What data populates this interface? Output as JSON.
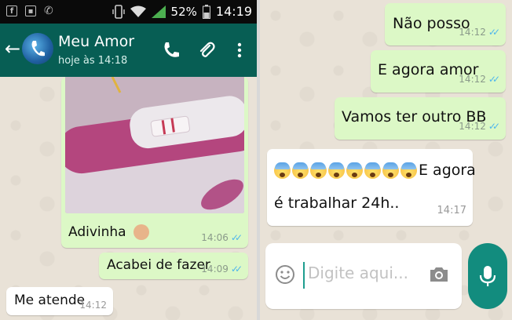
{
  "status_bar": {
    "battery": "52%",
    "time": "14:19"
  },
  "header": {
    "contact_name": "Meu Amor",
    "last_seen": "hoje às 14:18"
  },
  "left_messages": {
    "photo_caption": "Adivinha",
    "photo_time": "14:06",
    "msg2_text": "Acabei de fazer",
    "msg2_time": "14:09",
    "msg3_text": "Me atende",
    "msg3_time": "14:12"
  },
  "right_messages": {
    "msg1_text": "Não posso",
    "msg1_time": "14:12",
    "msg2_text": "E agora amor",
    "msg2_time": "14:12",
    "msg3_text": "Vamos ter outro BB",
    "msg3_time": "14:12",
    "msg4_text_line1": "E agora",
    "msg4_text_line2": "é trabalhar 24h..",
    "msg4_time": "14:17"
  },
  "input": {
    "placeholder": "Digite aqui..."
  },
  "icons": {
    "back": "arrow-left-icon",
    "call": "phone-icon",
    "attach": "paperclip-icon",
    "menu": "more-vertical-icon",
    "emoji": "emoji-smiley-icon",
    "camera": "camera-icon",
    "mic": "microphone-icon"
  },
  "colors": {
    "header": "#075e54",
    "outgoing_bubble": "#dcf8c6",
    "incoming_bubble": "#ffffff",
    "read_ticks": "#4fb6ec",
    "mic_button": "#128c7e"
  }
}
